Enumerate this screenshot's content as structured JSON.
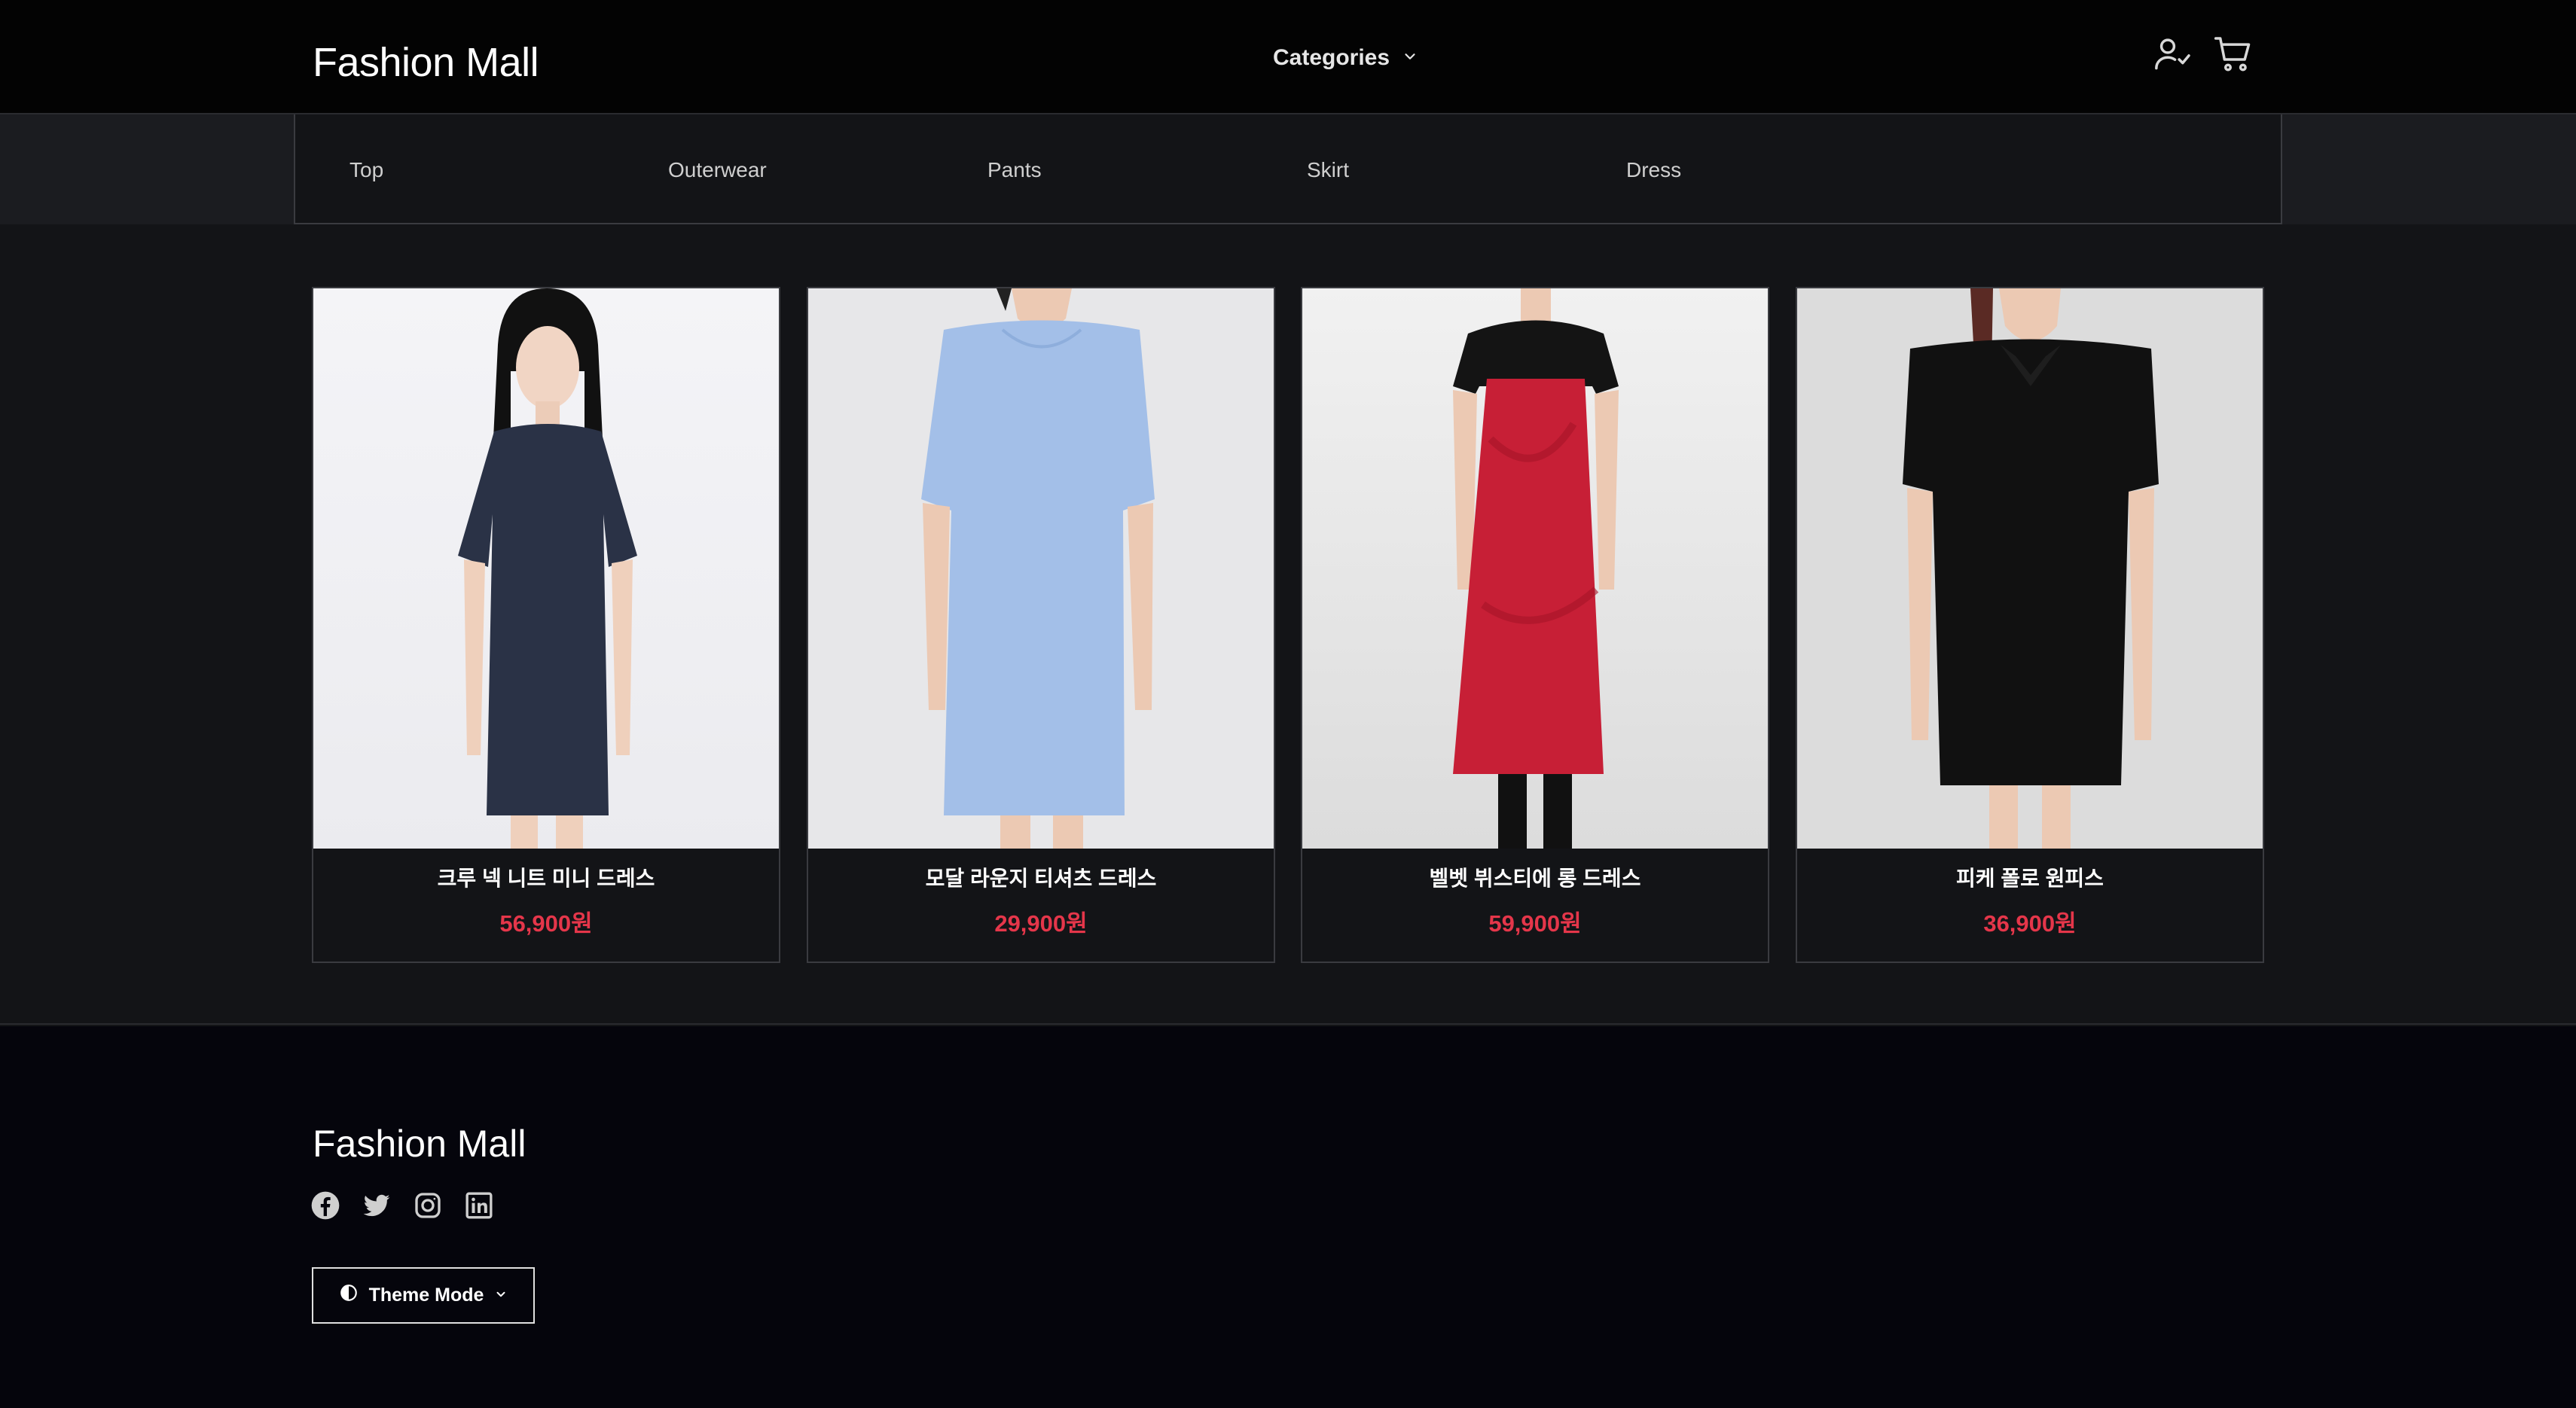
{
  "header": {
    "logo": "Fashion Mall",
    "categories_label": "Categories",
    "icons": [
      "user-check-icon",
      "cart-icon"
    ]
  },
  "category_menu": {
    "items": [
      {
        "label": "Top"
      },
      {
        "label": "Outerwear"
      },
      {
        "label": "Pants"
      },
      {
        "label": "Skirt"
      },
      {
        "label": "Dress"
      }
    ]
  },
  "products": [
    {
      "name": "크루 넥 니트 미니 드레스",
      "price": "56,900원",
      "image": "navy knit mini dress on model"
    },
    {
      "name": "모달 라운지 티셔츠 드레스",
      "price": "29,900원",
      "image": "light blue t-shirt dress on model"
    },
    {
      "name": "벨벳 뷔스티에 롱 드레스",
      "price": "59,900원",
      "image": "red velvet slip dress over black tee"
    },
    {
      "name": "피케 폴로 원피스",
      "price": "36,900원",
      "image": "black polo mini dress on model"
    }
  ],
  "footer": {
    "logo": "Fashion Mall",
    "social_icons": [
      "facebook-icon",
      "twitter-icon",
      "instagram-icon",
      "linkedin-icon"
    ],
    "theme_button_label": "Theme Mode"
  },
  "colors": {
    "header_bg": "#030303",
    "page_bg": "#131417",
    "footer_bg": "#05050c",
    "price": "#e5364a"
  }
}
